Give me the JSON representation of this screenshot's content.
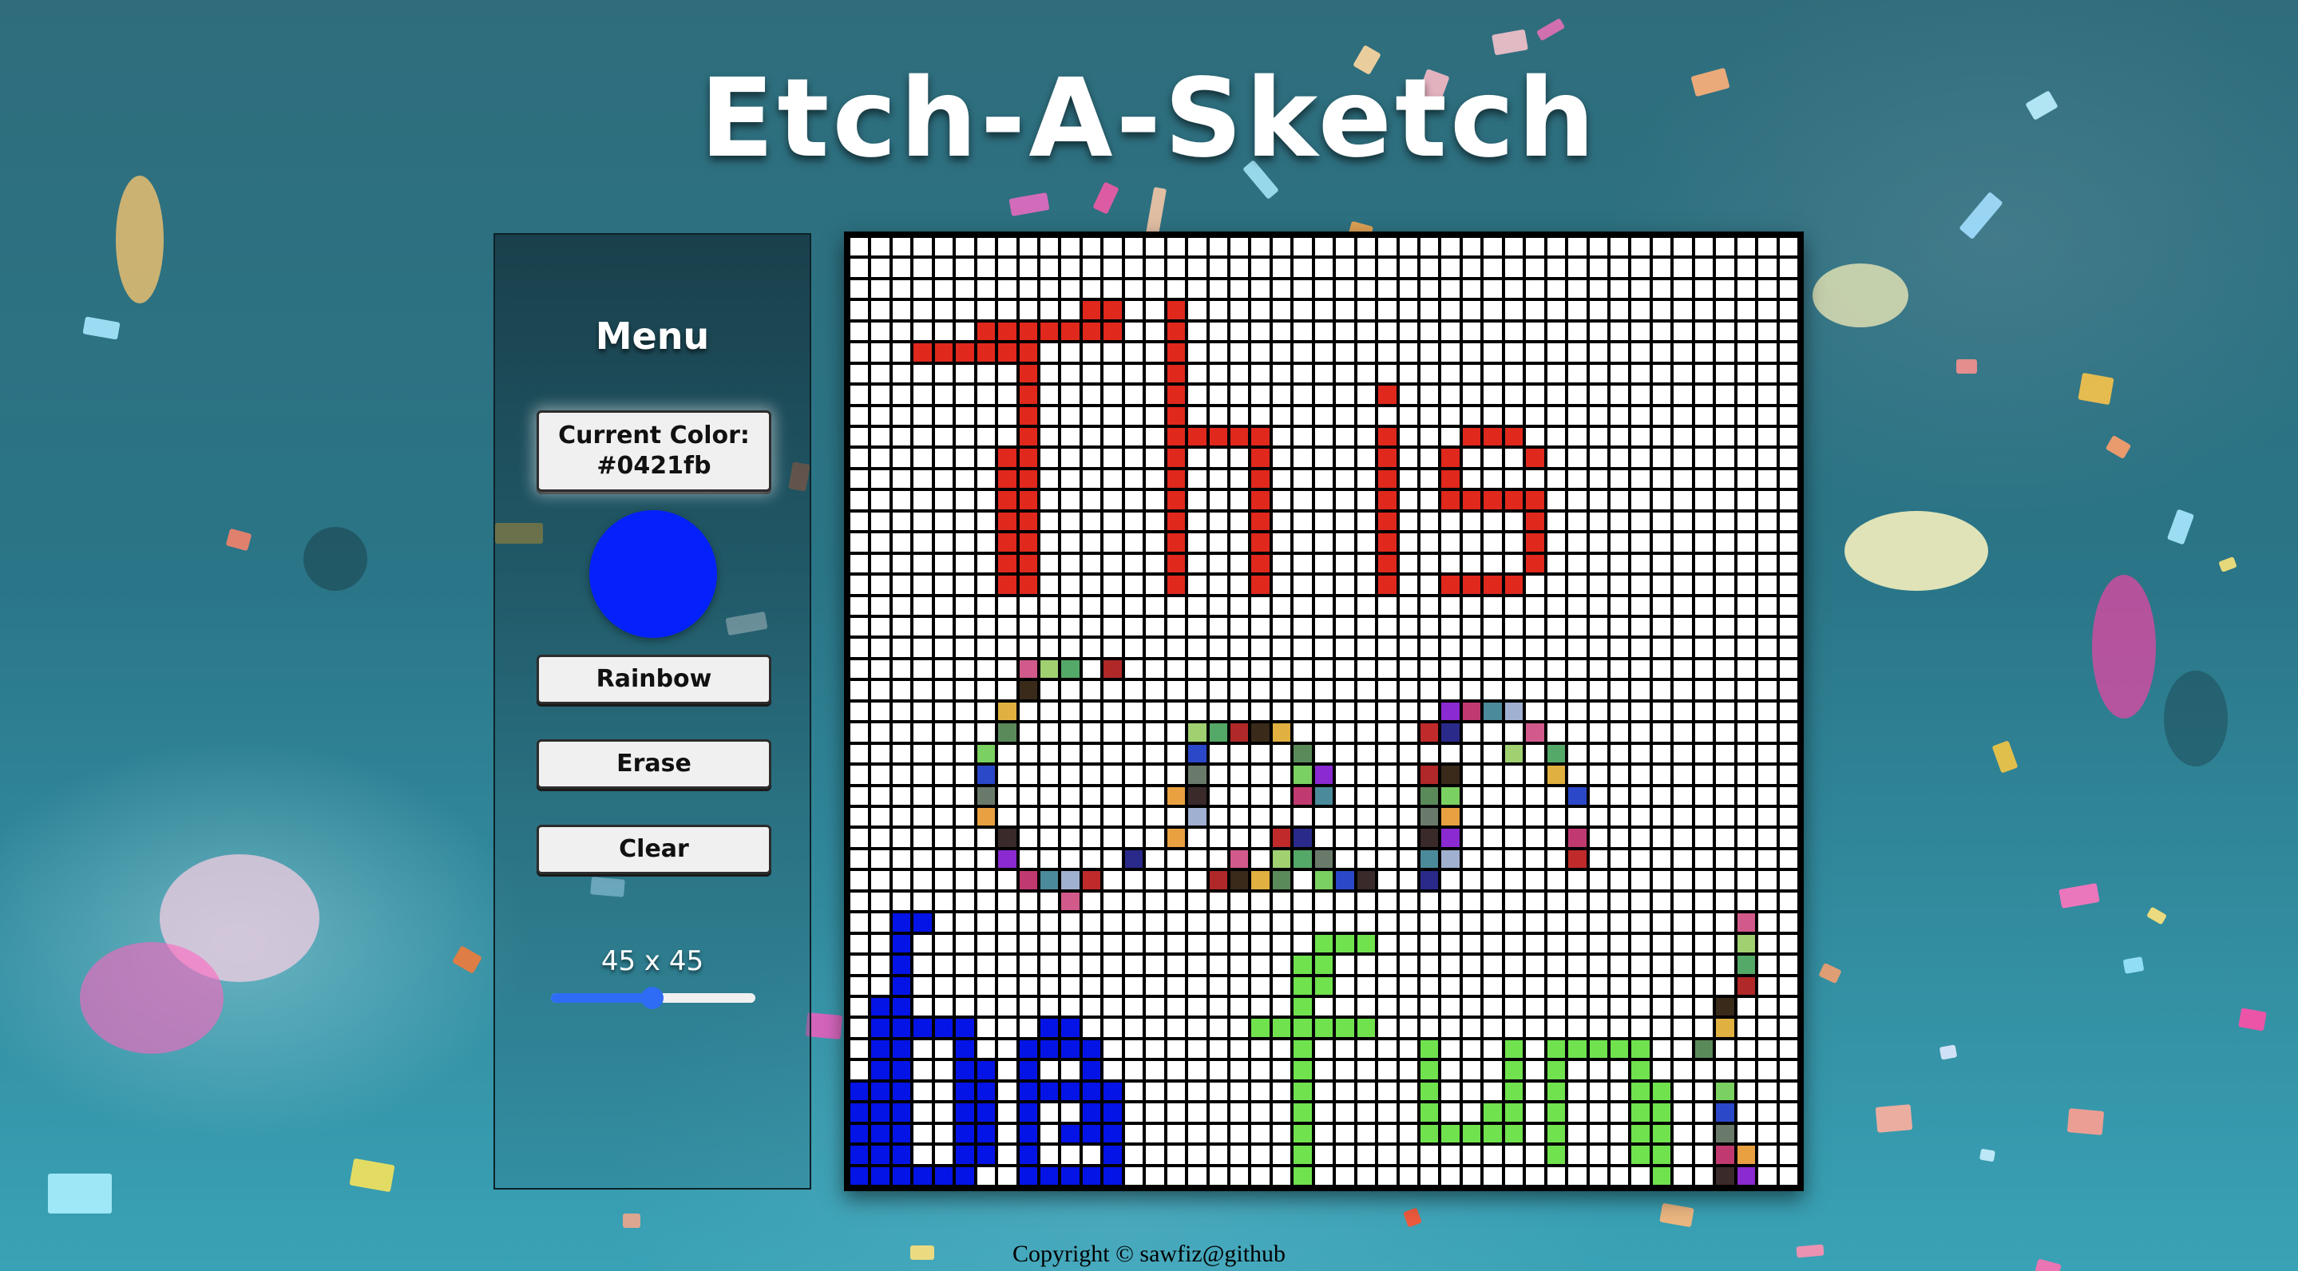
{
  "app": {
    "title": "Etch-A-Sketch",
    "footer": "Copyright © sawfiz@github"
  },
  "menu": {
    "title": "Menu",
    "current_color_label": "Current Color:",
    "current_color_value": "#0421fb",
    "rainbow_label": "Rainbow",
    "erase_label": "Erase",
    "clear_label": "Clear",
    "grid_size_label": "45 x 45",
    "grid_size_value": 45,
    "grid_size_min": 1,
    "grid_size_max": 90
  },
  "colors": {
    "current": "#0421fb",
    "board_text_red": "#e0281c",
    "board_text_blue": "#0414e6",
    "board_text_green": "#6fe24e"
  }
}
